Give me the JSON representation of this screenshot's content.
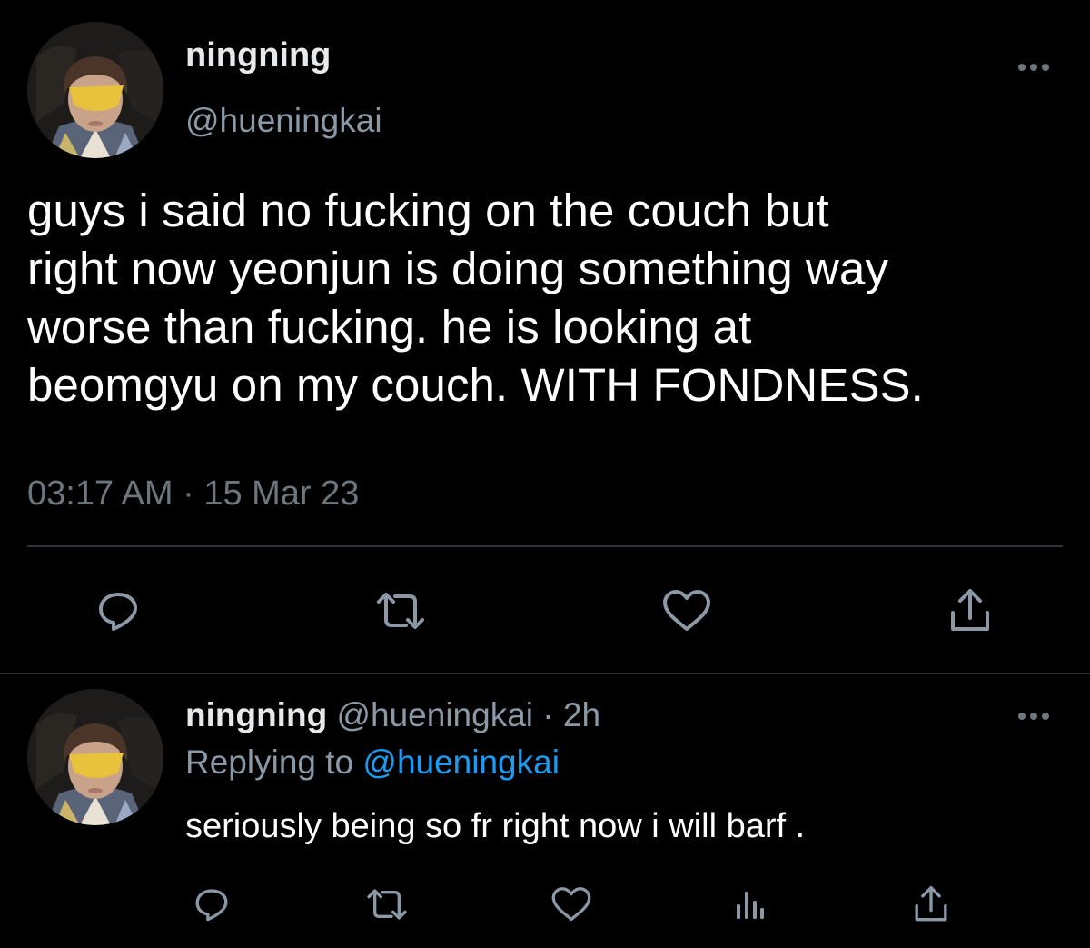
{
  "main_tweet": {
    "display_name": "ningning",
    "handle": "@hueningkai",
    "text_lines": [
      "guys i said no fucking on the couch but",
      "right now yeonjun is doing something way",
      "worse than fucking. he is looking at",
      "beomgyu on my couch. WITH FONDNESS."
    ],
    "timestamp": "03:17 AM · 15 Mar 23",
    "actions": {
      "reply_icon": "reply-icon",
      "retweet_icon": "retweet-icon",
      "like_icon": "like-icon",
      "share_icon": "share-icon"
    }
  },
  "reply_tweet": {
    "display_name": "ningning",
    "handle_time": "@hueningkai · 2h",
    "replying_prefix": "Replying to",
    "replying_handle": "@hueningkai",
    "text": "seriously being so fr right now i will barf .",
    "actions": {
      "reply_icon": "reply-icon",
      "retweet_icon": "retweet-icon",
      "like_icon": "like-icon",
      "analytics_icon": "analytics-icon",
      "share_icon": "share-icon"
    }
  },
  "colors": {
    "background": "#000000",
    "primary_text": "#e7e9ea",
    "secondary_text": "#8b98a5",
    "link": "#1d9bf0",
    "divider": "#2f3336"
  }
}
